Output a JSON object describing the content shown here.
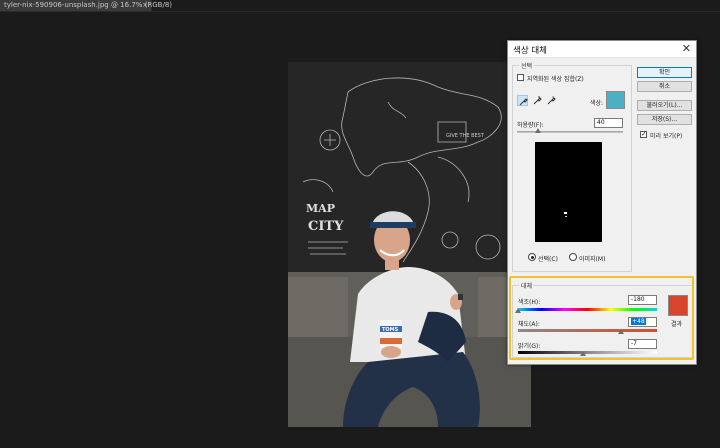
{
  "document_tab": {
    "title": "tyler-nix-590906-unsplash.jpg @ 16.7% (RGB/8)",
    "close": "×"
  },
  "dialog": {
    "title": "색상 대체",
    "close": "✕",
    "selection": {
      "group_label": "선택",
      "localized_clusters_label": "지역화된 색상 집합(Z)",
      "color_label": "색상:",
      "color_value": "#4bb0c6",
      "fuzziness_label": "허용량(F):",
      "fuzziness_value": "40",
      "fuzziness_level": 0.2,
      "radio_selection": "선택(C)",
      "radio_image": "이미지(M)"
    },
    "replacement": {
      "group_label": "대체",
      "hue_label": "색조(H):",
      "hue_value": "-180",
      "saturation_label": "채도(A):",
      "saturation_value": "+48",
      "lightness_label": "밝기(G):",
      "lightness_value": "-7",
      "result_label": "결과",
      "result_color": "#d9452a"
    },
    "buttons": {
      "ok": "확인",
      "cancel": "취소",
      "load": "불러오기(L)...",
      "save": "저장(S)...",
      "preview": "미리 보기(P)"
    }
  },
  "colors": {
    "app_background": "#1b1b1b",
    "highlight": "#f2c12e",
    "accent": "#0078d7"
  }
}
